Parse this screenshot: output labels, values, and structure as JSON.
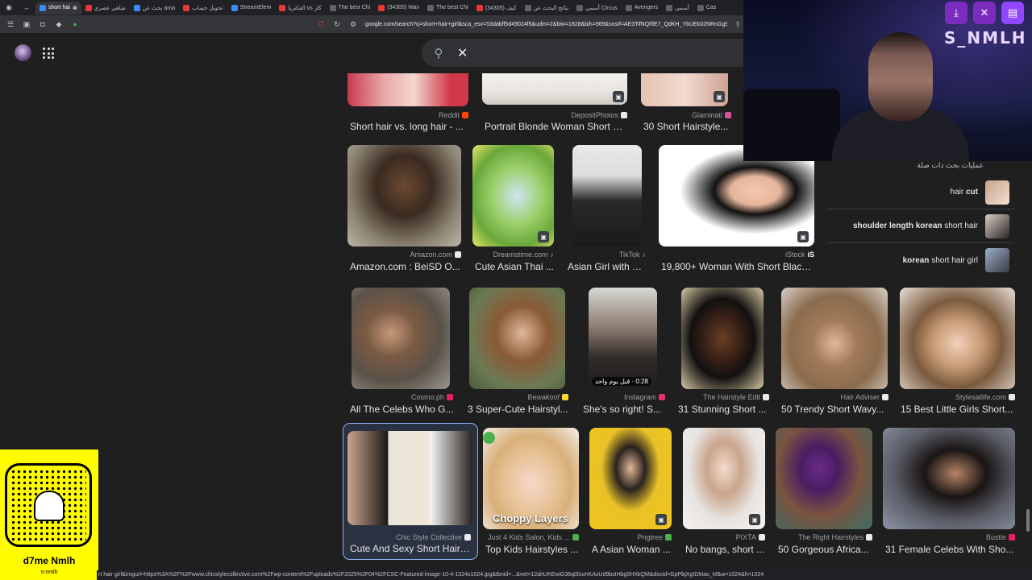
{
  "browser": {
    "tabs": [
      {
        "label": "short hai",
        "icon": "google-icon",
        "active": true
      },
      {
        "label": "شاهي عصري",
        "icon": "page-icon"
      },
      {
        "label": "بحث عن ama",
        "icon": "page-icon"
      },
      {
        "label": "تحويل حساب",
        "icon": "page-icon"
      },
      {
        "label": "StreamElem",
        "icon": "page-icon"
      },
      {
        "label": "الفكتريا vs كار",
        "icon": "page-icon"
      },
      {
        "label": "The best Chi",
        "icon": "page-icon"
      },
      {
        "label": "(34305) Wav",
        "icon": "page-icon"
      },
      {
        "label": "The best Chi",
        "icon": "page-icon"
      },
      {
        "label": "(34305) كيف",
        "icon": "page-icon"
      },
      {
        "label": "نتائج البحث عن",
        "icon": "page-icon"
      },
      {
        "label": "أسمي Circus",
        "icon": "page-icon"
      },
      {
        "label": "Avengers",
        "icon": "page-icon"
      },
      {
        "label": "أسمي",
        "icon": "page-icon"
      },
      {
        "label": "Cas",
        "icon": "page-icon"
      }
    ],
    "url": "google.com/search?q=short+hair+girl&sca_esv=53dabff5d49024f6&udm=2&biw=1828&bih=969&sxsrf=AE3TifNQIfIE7_QdKH_YbUEk02NRnGg9HA..."
  },
  "search": {
    "icons": [
      "search-icon",
      "close-icon"
    ]
  },
  "results": {
    "row0": [
      {
        "source": "Reddit",
        "title": "Short hair vs. long hair - ...",
        "fav": "#ff4500"
      },
      {
        "source": "DepositPhotos",
        "title": "Portrait Blonde Woman Short Ha...",
        "fav": "#e8eaed"
      },
      {
        "source": "Glaminati",
        "title": "30 Short Hairstyle...",
        "fav": "#d84f9b"
      }
    ],
    "row1": [
      {
        "source": "Amazon.com",
        "title": "Amazon.com : BeiSD O...",
        "fav": "#e8eaed"
      },
      {
        "source": "Dreamstime.com",
        "title": "Cute Asian Thai ...",
        "fav": "#e8eaed"
      },
      {
        "source": "TikTok",
        "title": "Asian Girl with S...",
        "fav": "#e8eaed"
      },
      {
        "source": "iStock",
        "title": "19,800+ Woman With Short Black ...",
        "fav": "#e8eaed"
      }
    ],
    "row2": [
      {
        "source": "Cosmo.ph",
        "title": "All The Celebs Who G...",
        "fav": "#e91e63"
      },
      {
        "source": "Bewakoof",
        "title": "3 Super-Cute Hairstyl...",
        "fav": "#fdd835"
      },
      {
        "source": "Instagram",
        "title": "She's so right! S...",
        "fav": "#e1306c",
        "duration": "0:28 · قبل يوم واحد"
      },
      {
        "source": "The Hairstyle Edit",
        "title": "31 Stunning Short ...",
        "fav": "#e8eaed"
      },
      {
        "source": "Hair Adviser",
        "title": "50 Trendy Short Wavy...",
        "fav": "#e8eaed"
      },
      {
        "source": "Stylesatlife.com",
        "title": "15 Best Little Girls Short...",
        "fav": "#e8eaed"
      }
    ],
    "row3": [
      {
        "source": "Chic Style Collective",
        "title": "Cute And Sexy Short Hairc...",
        "fav": "#e8eaed"
      },
      {
        "source": "Just 4 Kids Salon, Kids ...",
        "title": "Top Kids Hairstyles ...",
        "fav": "#4caf50",
        "overlay": "Choppy Layers"
      },
      {
        "source": "Pngtree",
        "title": "A Asian Woman ...",
        "fav": "#4caf50"
      },
      {
        "source": "PIXTA",
        "title": "No bangs, short ...",
        "fav": "#e8eaed"
      },
      {
        "source": "The Right Hairstyles",
        "title": "50 Gorgeous Africa...",
        "fav": "#e8eaed"
      },
      {
        "source": "Bustle",
        "title": "31 Female Celebs With Sho...",
        "fav": "#e91e63"
      }
    ]
  },
  "related": {
    "header": "عمليات بحث ذات صلة",
    "items": [
      {
        "bold": "cut",
        "pre": "hair ",
        "post": ""
      },
      {
        "bold": "shoulder length korean",
        "pre": "",
        "post": " short hair"
      },
      {
        "bold": "korean",
        "pre": "",
        "post": " short hair girl"
      }
    ]
  },
  "stream": {
    "channel": "S_NMLH",
    "buttons": [
      "download-icon",
      "close-circle-icon",
      "twitch-icon"
    ]
  },
  "snapchat": {
    "name": "d7me Nmlh",
    "username": "s-nmlh"
  },
  "statusbar": {
    "text": "rt hair girl&imgurl=https%3A%2F%2Fwww.chicstylecollective.com%2Fwp-content%2Fuploads%2F2025%2F04%2FCSC-Featured-image-10-4-1024x1024.jpg&tbnid=...&vet=12ahUKEwiG36q00umKAxUd9bsIHbg0HXkQM&docid=GpPbjXgIDMao_M&w=1024&h=1024"
  }
}
